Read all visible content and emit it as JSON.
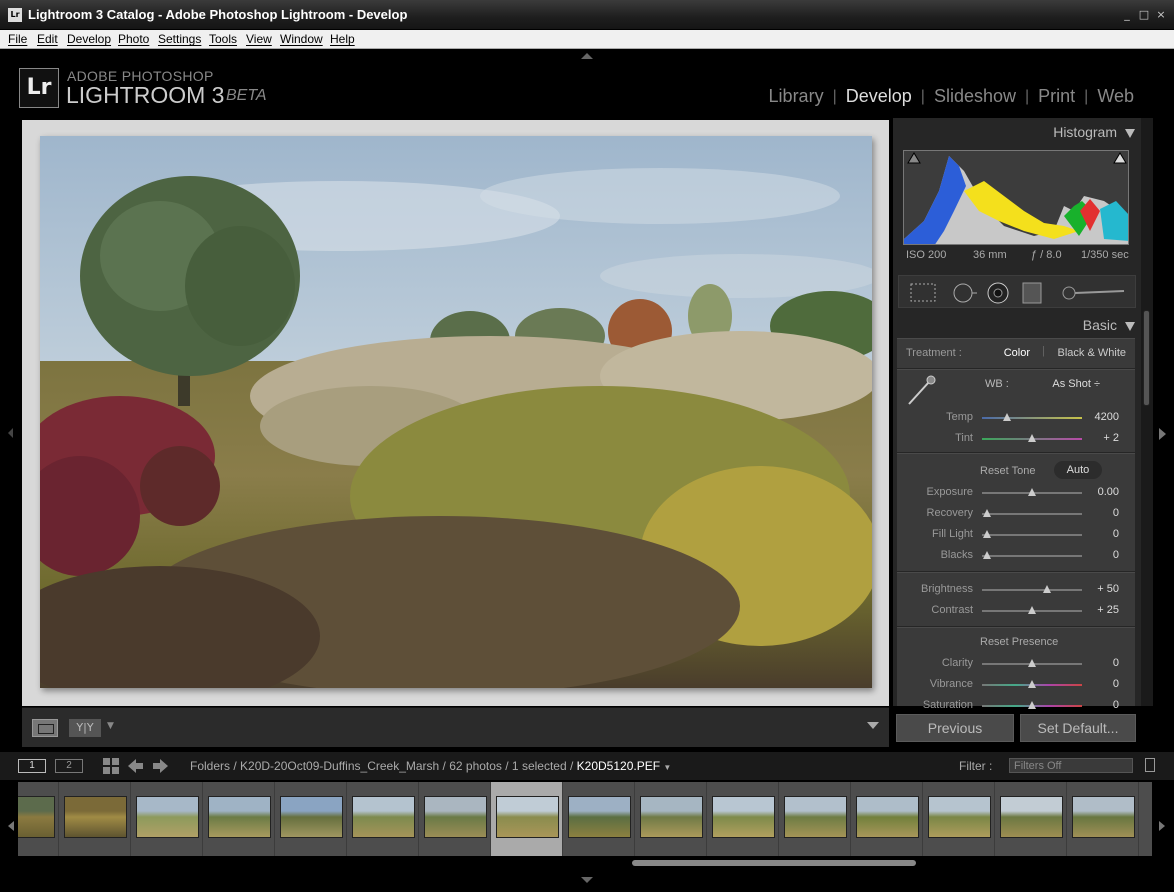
{
  "window": {
    "title": "Lightroom 3 Catalog - Adobe Photoshop Lightroom - Develop",
    "icon_text": "Lr",
    "controls": [
      "_",
      "□",
      "×"
    ]
  },
  "menu": [
    "File",
    "Edit",
    "Develop",
    "Photo",
    "Settings",
    "Tools",
    "View",
    "Window",
    "Help"
  ],
  "identity": {
    "badge": "Lr",
    "line1": "ADOBE PHOTOSHOP",
    "line2": "LIGHTROOM 3",
    "tag": "BETA"
  },
  "modules": [
    "Library",
    "Develop",
    "Slideshow",
    "Print",
    "Web"
  ],
  "active_module": "Develop",
  "histogram": {
    "title": "Histogram",
    "iso": "ISO 200",
    "focal": "36 mm",
    "aperture": "ƒ / 8.0",
    "shutter": "1/350 sec"
  },
  "basic": {
    "title": "Basic",
    "treatment_label": "Treatment :",
    "treatment_color": "Color",
    "treatment_bw": "Black & White",
    "wb_label": "WB :",
    "wb_value": "As Shot ÷",
    "reset_tone": "Reset Tone",
    "auto": "Auto",
    "reset_presence": "Reset Presence",
    "sliders": [
      {
        "label": "Temp",
        "value": "4200",
        "pos": 0.25
      },
      {
        "label": "Tint",
        "value": "+ 2",
        "pos": 0.5
      },
      {
        "label": "Exposure",
        "value": "0.00",
        "pos": 0.5
      },
      {
        "label": "Recovery",
        "value": "0",
        "pos": 0.05
      },
      {
        "label": "Fill Light",
        "value": "0",
        "pos": 0.05
      },
      {
        "label": "Blacks",
        "value": "0",
        "pos": 0.05
      },
      {
        "label": "Brightness",
        "value": "+ 50",
        "pos": 0.65
      },
      {
        "label": "Contrast",
        "value": "+ 25",
        "pos": 0.5
      },
      {
        "label": "Clarity",
        "value": "0",
        "pos": 0.5
      },
      {
        "label": "Vibrance",
        "value": "0",
        "pos": 0.5
      },
      {
        "label": "Saturation",
        "value": "0",
        "pos": 0.5
      }
    ]
  },
  "buttons": {
    "previous": "Previous",
    "set_default": "Set Default..."
  },
  "filmstrip": {
    "view1": "1",
    "view2": "2",
    "path_prefix": "Folders / K20D-20Oct09-Duffins_Creek_Marsh / 62 photos / 1 selected /",
    "filename": "K20D5120.PEF",
    "filter_label": "Filter :",
    "filter_value": "Filters Off",
    "selected_index": 7
  }
}
